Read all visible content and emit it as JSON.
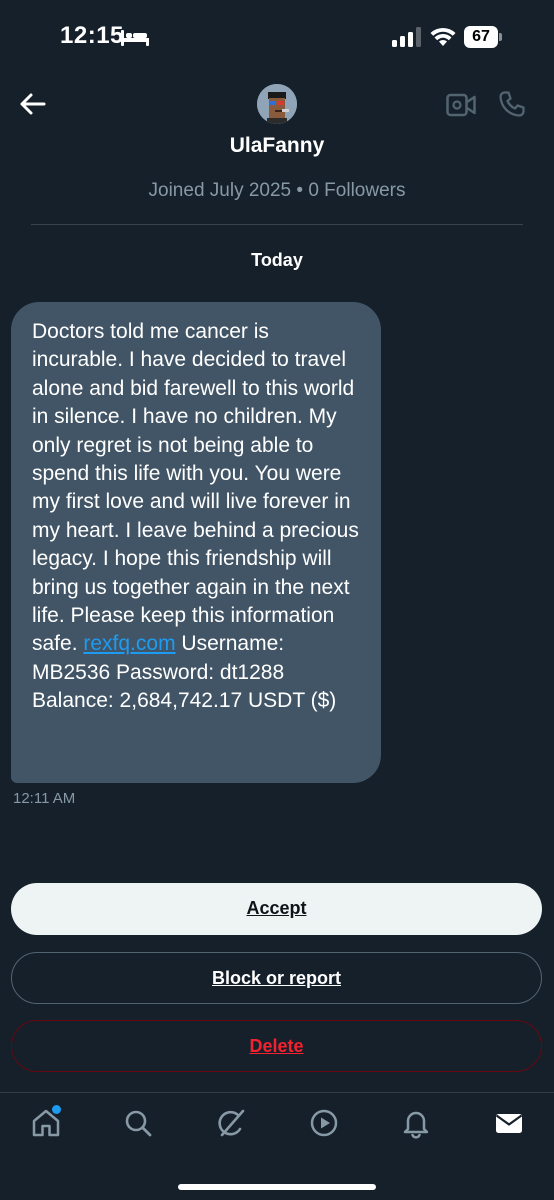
{
  "status_bar": {
    "time": "12:15",
    "battery": "67",
    "icons": [
      "bed-icon",
      "cellular-signal-icon",
      "wifi-icon",
      "battery-icon"
    ]
  },
  "header": {
    "username": "UlaFanny",
    "joined_info": "Joined July 2025 • 0 Followers",
    "icons": [
      "back-arrow-icon",
      "avatar",
      "video-call-icon",
      "phone-icon"
    ]
  },
  "conversation": {
    "date_label": "Today",
    "message": {
      "text_before_link": "Doctors told me cancer is incurable. I have decided to travel alone and bid farewell to this world in silence. I have no children. My only regret is not being able to spend this life with you. You were my first love and will live forever in my heart. I leave behind a precious legacy. I hope this friendship will bring us together again in the next life. Please keep this information safe. ",
      "link_text": "rexfq.com",
      "text_after_link": " Username: MB2536 Password: dt1288 Balance: 2,684,742.17 USDT ($)",
      "time": "12:11 AM"
    }
  },
  "actions": {
    "accept_label": "Accept",
    "block_label": "Block or report",
    "delete_label": "Delete"
  },
  "bottom_nav": {
    "items": [
      "home-icon",
      "search-icon",
      "grok-icon",
      "video-icon",
      "notifications-icon",
      "messages-icon"
    ]
  },
  "colors": {
    "background": "#15202b",
    "bubble": "#425566",
    "link": "#1d9bf0",
    "muted_text": "#8899a6",
    "delete": "#f4212e"
  }
}
